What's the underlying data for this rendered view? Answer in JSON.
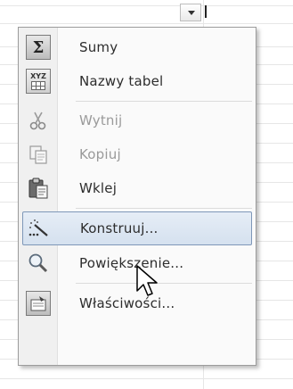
{
  "menu": {
    "items": [
      {
        "label": "Sumy",
        "icon": "sigma-icon",
        "enabled": true,
        "highlighted": false
      },
      {
        "label": "Nazwy tabel",
        "icon": "xyz-table-icon",
        "enabled": true,
        "highlighted": false
      },
      {
        "label": "Wytnij",
        "icon": "scissors-icon",
        "enabled": false,
        "highlighted": false
      },
      {
        "label": "Kopiuj",
        "icon": "copy-icon",
        "enabled": false,
        "highlighted": false
      },
      {
        "label": "Wklej",
        "icon": "paste-icon",
        "enabled": true,
        "highlighted": false
      },
      {
        "label": "Konstruuj...",
        "icon": "wand-icon",
        "enabled": true,
        "highlighted": true
      },
      {
        "label": "Powiększenie...",
        "icon": "magnifier-icon",
        "enabled": true,
        "highlighted": false
      },
      {
        "label": "Właściwości...",
        "icon": "properties-icon",
        "enabled": true,
        "highlighted": false
      }
    ]
  },
  "colors": {
    "highlight_border": "#7e97b8",
    "highlight_fill": "#d5e1ef",
    "disabled_text": "#9a9a9a"
  }
}
